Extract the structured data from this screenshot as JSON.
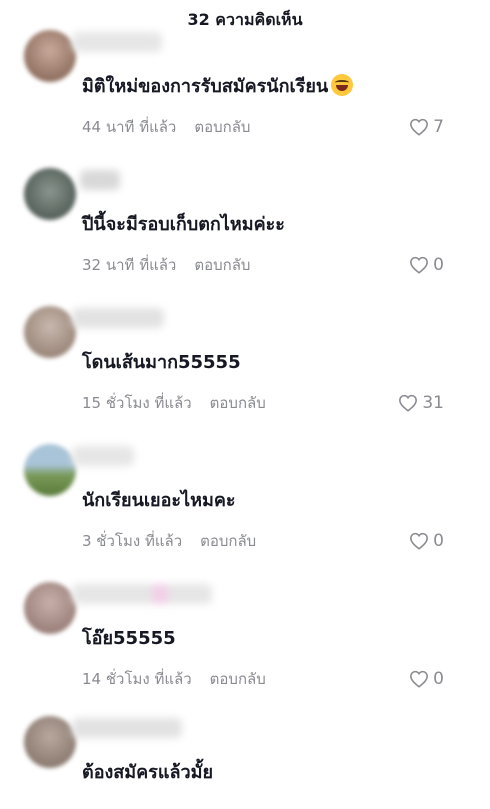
{
  "header": {
    "title": "32 ความคิดเห็น"
  },
  "comments": [
    {
      "text": "มิติใหม่ของการรับสมัครนักเรียน",
      "has_emoji": true,
      "emoji_icon": "laughing-tears-emoji",
      "time": "44 นาที ที่แล้ว",
      "reply_label": "ตอบกลับ",
      "likes": "7",
      "avatar_color": "#8a6a5a"
    },
    {
      "text": "ปีนี้จะมีรอบเก็บตกไหมค่ะะ",
      "has_emoji": false,
      "time": "32 นาที ที่แล้ว",
      "reply_label": "ตอบกลับ",
      "likes": "0",
      "avatar_color": "#5a6660"
    },
    {
      "text": "โดนเส้นมาก55555",
      "has_emoji": false,
      "time": "15 ชั่วโมง ที่แล้ว",
      "reply_label": "ตอบกลับ",
      "likes": "31",
      "avatar_color": "#9a8a80"
    },
    {
      "text": "นักเรียนเยอะไหมคะ",
      "has_emoji": false,
      "time": "3 ชั่วโมง ที่แล้ว",
      "reply_label": "ตอบกลับ",
      "likes": "0",
      "avatar_color": "#8aa07a"
    },
    {
      "text": "โอ๊ย55555",
      "has_emoji": false,
      "time": "14 ชั่วโมง ที่แล้ว",
      "reply_label": "ตอบกลับ",
      "likes": "0",
      "avatar_color": "#a09090"
    },
    {
      "text": "ต้องสมัครแล้วมั้ย",
      "has_emoji": false,
      "time": "",
      "reply_label": "",
      "likes": "",
      "avatar_color": "#8a7a70"
    }
  ]
}
